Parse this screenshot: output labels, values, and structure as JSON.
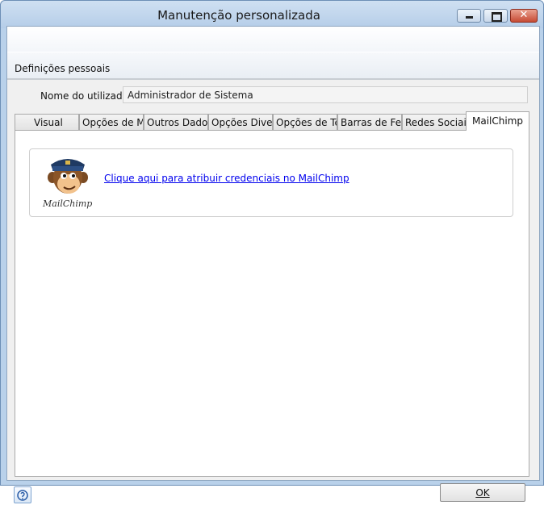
{
  "window": {
    "title": "Manutenção personalizada",
    "close_glyph": "✕"
  },
  "section": {
    "label": "Definições pessoais"
  },
  "user": {
    "label": "Nome do utilizador",
    "value": "Administrador de Sistema"
  },
  "tabs": [
    {
      "label": "Visual"
    },
    {
      "label": "Opções de Ma"
    },
    {
      "label": "Outros Dados"
    },
    {
      "label": "Opções Divers"
    },
    {
      "label": "Opções de Tel"
    },
    {
      "label": "Barras de Ferra"
    },
    {
      "label": "Redes Sociais"
    },
    {
      "label": "MailChimp"
    }
  ],
  "active_tab": "MailChimp",
  "mailchimp": {
    "logo_text": "MailChimp",
    "link_text": "Clique aqui para atribuir credenciais no MailChimp"
  },
  "footer": {
    "ok_label": "OK",
    "help_icon": "help-icon"
  },
  "colors": {
    "link": "#0000ee",
    "close_button": "#c74b34",
    "titlebar": "#b5cde8"
  }
}
